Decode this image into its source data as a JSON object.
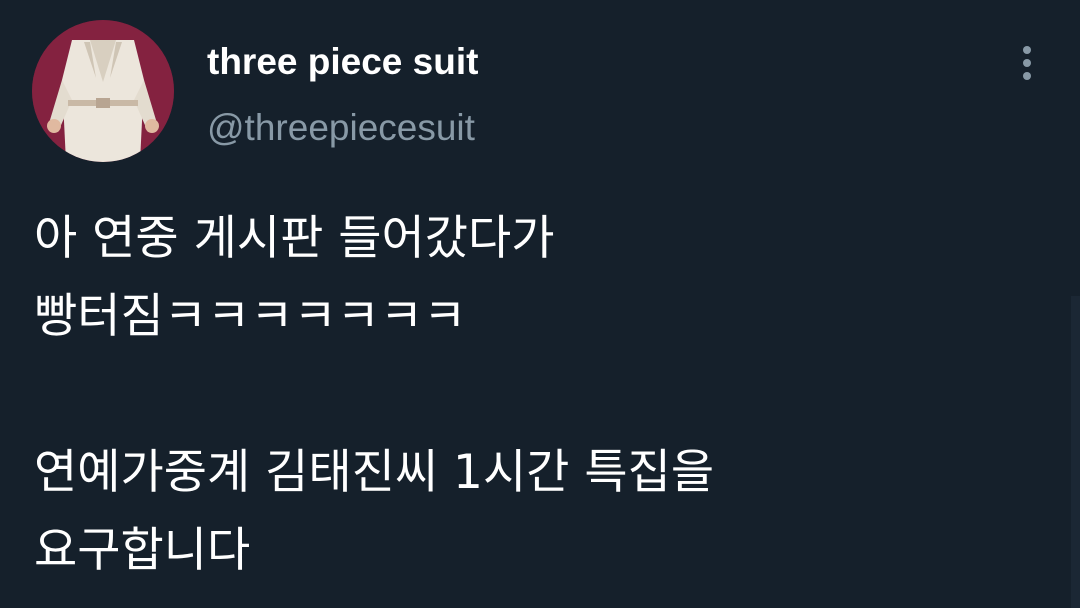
{
  "tweet": {
    "display_name": "three piece suit",
    "handle": "@threepiecesuit",
    "more_icon": "vertical-ellipsis-icon",
    "avatar": "profile-photo-white-blazer",
    "text_lines": [
      "아 연중 게시판 들어갔다가",
      "빵터짐ㅋㅋㅋㅋㅋㅋㅋ",
      "",
      "연예가중계 김태진씨 1시간 특집을",
      "요구합니다"
    ]
  },
  "colors": {
    "background": "#15202b",
    "primary_text": "#ffffff",
    "secondary_text": "#8899a6"
  }
}
